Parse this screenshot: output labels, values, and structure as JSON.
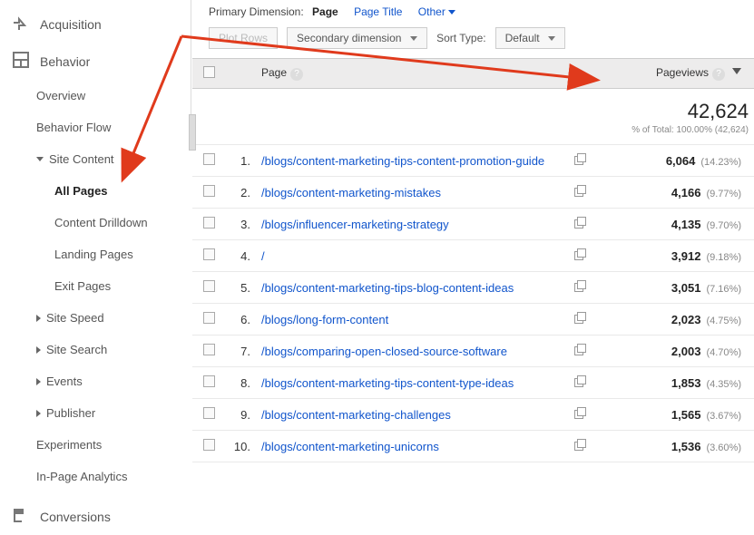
{
  "sidebar": {
    "acquisition": "Acquisition",
    "behavior": "Behavior",
    "overview": "Overview",
    "behaviorFlow": "Behavior Flow",
    "siteContent": "Site Content",
    "allPages": "All Pages",
    "contentDrilldown": "Content Drilldown",
    "landingPages": "Landing Pages",
    "exitPages": "Exit Pages",
    "siteSpeed": "Site Speed",
    "siteSearch": "Site Search",
    "events": "Events",
    "publisher": "Publisher",
    "experiments": "Experiments",
    "inpage": "In-Page Analytics",
    "conversions": "Conversions"
  },
  "dim": {
    "label": "Primary Dimension:",
    "page": "Page",
    "pageTitle": "Page Title",
    "other": "Other"
  },
  "ctrl": {
    "plotRows": "Plot Rows",
    "secondary": "Secondary dimension",
    "sortType": "Sort Type:",
    "defaultOpt": "Default"
  },
  "table": {
    "pageHeader": "Page",
    "pvHeader": "Pageviews",
    "totalValue": "42,624",
    "totalSub": "% of Total: 100.00% (42,624)",
    "rows": [
      {
        "rank": "1.",
        "page": "/blogs/content-marketing-tips-content-promotion-guide",
        "pv": "6,064",
        "pct": "(14.23%)"
      },
      {
        "rank": "2.",
        "page": "/blogs/content-marketing-mistakes",
        "pv": "4,166",
        "pct": "(9.77%)"
      },
      {
        "rank": "3.",
        "page": "/blogs/influencer-marketing-strategy",
        "pv": "4,135",
        "pct": "(9.70%)"
      },
      {
        "rank": "4.",
        "page": "/",
        "pv": "3,912",
        "pct": "(9.18%)"
      },
      {
        "rank": "5.",
        "page": "/blogs/content-marketing-tips-blog-content-ideas",
        "pv": "3,051",
        "pct": "(7.16%)"
      },
      {
        "rank": "6.",
        "page": "/blogs/long-form-content",
        "pv": "2,023",
        "pct": "(4.75%)"
      },
      {
        "rank": "7.",
        "page": "/blogs/comparing-open-closed-source-software",
        "pv": "2,003",
        "pct": "(4.70%)"
      },
      {
        "rank": "8.",
        "page": "/blogs/content-marketing-tips-content-type-ideas",
        "pv": "1,853",
        "pct": "(4.35%)"
      },
      {
        "rank": "9.",
        "page": "/blogs/content-marketing-challenges",
        "pv": "1,565",
        "pct": "(3.67%)"
      },
      {
        "rank": "10.",
        "page": "/blogs/content-marketing-unicorns",
        "pv": "1,536",
        "pct": "(3.60%)"
      }
    ]
  }
}
